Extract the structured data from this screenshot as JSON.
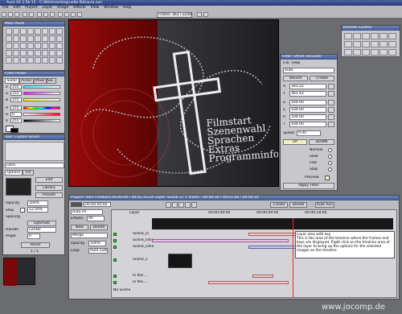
{
  "window": {
    "title": "Aura V2 2.5b 15  - C:\\Weihnachtsgrueße.fkb\\aura.aus"
  },
  "menu": [
    "File",
    "Edit",
    "Project",
    "Layer",
    "Image",
    "Effects",
    "View",
    "Window",
    "Help"
  ],
  "toolbar": {
    "frame_readout": "Frame: 361 / 2259"
  },
  "tools_panel": {
    "title": "Main Panel"
  },
  "color_panel": {
    "title": "Color Picker",
    "tabs": [
      "Slider",
      "Picker",
      "Mixer",
      "Sw..."
    ],
    "channels": [
      {
        "label": "R",
        "value": "255"
      },
      {
        "label": "G",
        "value": "255"
      },
      {
        "label": "B",
        "value": "255"
      },
      {
        "label": "H",
        "value": "255"
      },
      {
        "label": "S",
        "value": "0"
      },
      {
        "label": "V",
        "value": "255"
      }
    ]
  },
  "tool_panel": {
    "title": "Tool: Custom Brush",
    "select_value": "Lotia",
    "tabs": [
      "Options",
      "Fill"
    ],
    "edit_label": "Edit",
    "buttons": [
      "Library",
      "Presets"
    ],
    "opacity_label": "Opacity",
    "opacity_value": "100%",
    "step_label": "Step",
    "step_value": "12.50%",
    "spacing_label": "Spacing",
    "optimize_label": "Optimize",
    "handle_label": "Handle",
    "handle_value": "Center",
    "angle_label": "Angle",
    "angle_value": "0",
    "reset_label": "Reset",
    "page_label": "1 / 1"
  },
  "canvas": {
    "text_lines": [
      "Filmstart",
      "Szenenwahl",
      "Sprachen",
      "Extras",
      "Programminfo"
    ]
  },
  "remote_panel": {
    "title": "Remote Control"
  },
  "filter_panel": {
    "title": "Filter: Offset Recorder",
    "menu": [
      "File",
      "Help"
    ],
    "select_value": "Auto",
    "record_label": "Record",
    "create_label": "Create",
    "fields": [
      {
        "label": "X",
        "value": "183.22"
      },
      {
        "label": "Y",
        "value": "361.43"
      },
      {
        "label": "Z",
        "value": "100.00"
      },
      {
        "label": "S",
        "value": "100.00"
      },
      {
        "label": "R",
        "value": "100.00"
      },
      {
        "label": "T",
        "value": "100.00"
      }
    ],
    "speed_label": "Speed",
    "speed_value": "0.00",
    "up_label": "UP",
    "down_label": "DOWN",
    "normal_label": "Normal",
    "slow_label": "Slow",
    "fast_label": "Fast",
    "stop_label": "Stop",
    "preview_label": "Preview",
    "apply_label": "Apply Filter"
  },
  "timeline": {
    "title": "Project: Intro Fontkürz 00:00:00 / 00:01:25:24     Layer: Scene 3 / 1 frame - 00:00:30 / 00:01:00 / 00:00:10",
    "timecode": "00:00:00:00",
    "mode_select": "Auto Fit",
    "effects_label": "Effects",
    "effects_value": "All",
    "new_label": "New",
    "delete_label": "Delete",
    "merge_label": "Merge",
    "opacity_label": "Opacity",
    "opacity_value": "100%",
    "loop_label": "Loop",
    "loop_value": "Hold Last",
    "layer_header": "Layer",
    "create_label": "Create",
    "delete_btn": "Delete",
    "autorun_label": "Auto Run",
    "ruler": [
      "00:00:00:00",
      "00:00:09:00",
      "00:00:18:00"
    ],
    "layers": [
      "Scene_in",
      "Scene_intro",
      "Scene_intro",
      "Scene_1",
      "In the ...",
      "In the ...",
      "No Scene"
    ],
    "tooltip": "Layer area with key\nThis is the area of the timeline where the frames and keys are displayed. Right click on the timeline area of the layer to bring up the options for the selected images on the timeline"
  },
  "watermark": "www.jocomp.de",
  "colors": {
    "accent": "#3e5590",
    "canvas_red": "#8a0a0a",
    "playhead": "#ff2020"
  }
}
